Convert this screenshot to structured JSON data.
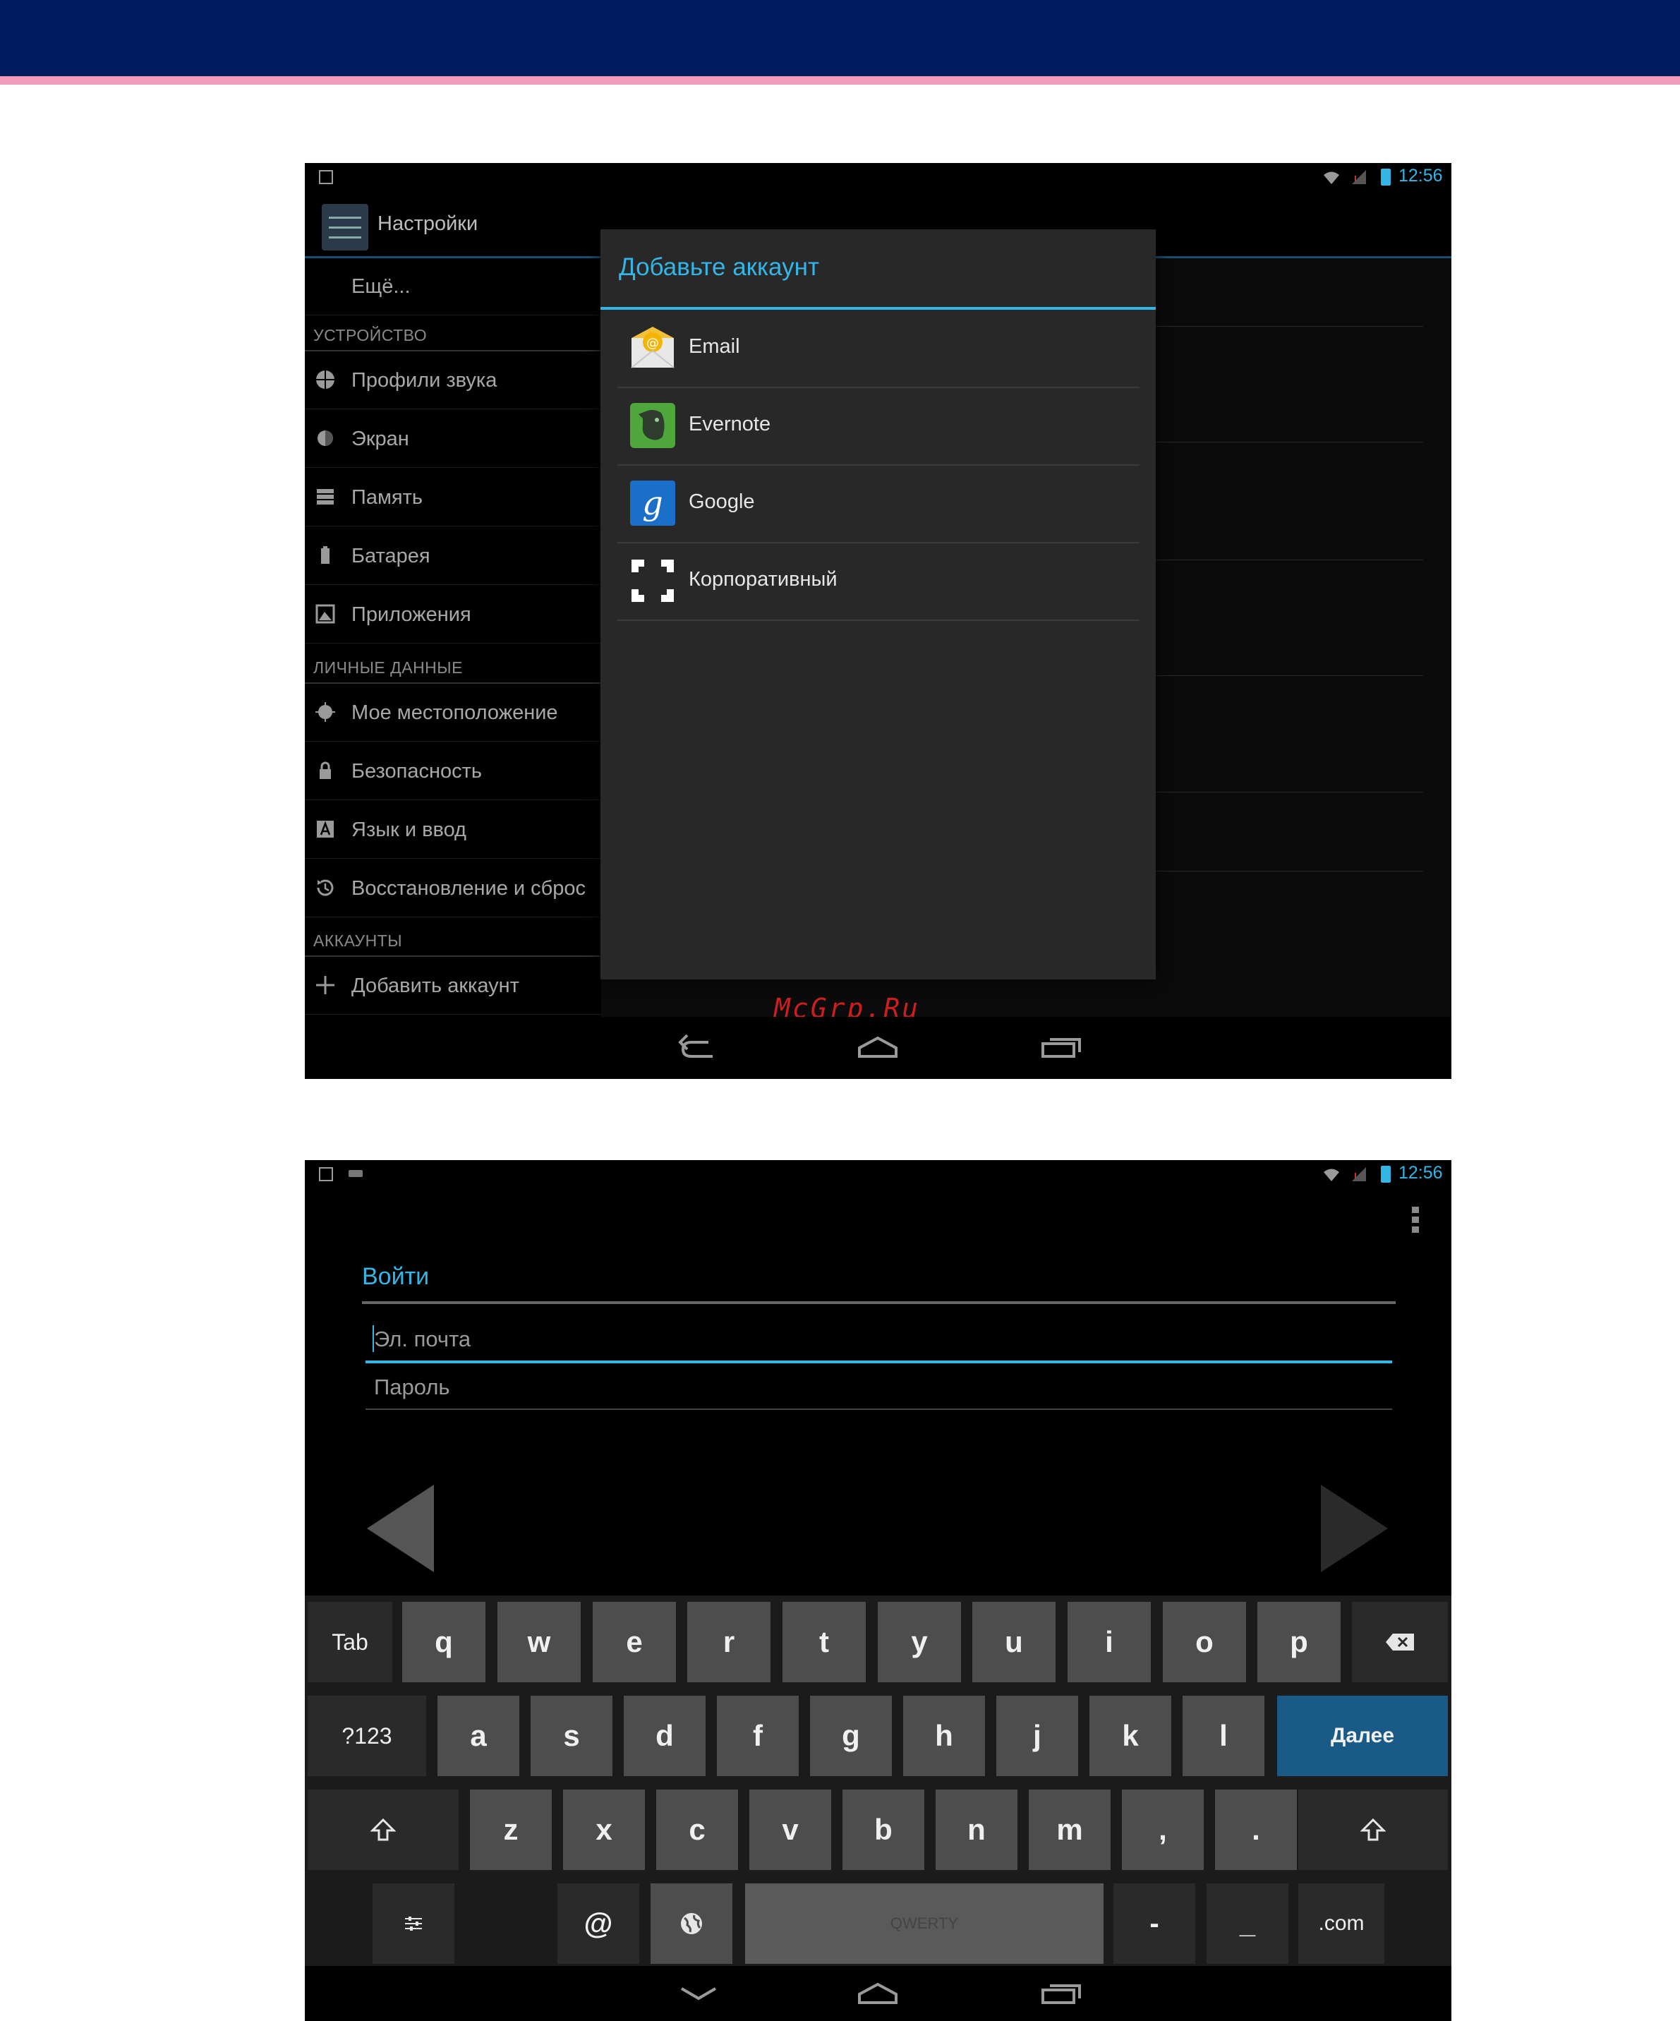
{
  "screen1": {
    "status": {
      "time": "12:56"
    },
    "action_bar": {
      "title": "Настройки"
    },
    "more_item": "Ещё...",
    "sections": [
      {
        "header": "УСТРОЙСТВО",
        "items": [
          "Профили звука",
          "Экран",
          "Память",
          "Батарея",
          "Приложения"
        ]
      },
      {
        "header": "ЛИЧНЫЕ ДАННЫЕ",
        "items": [
          "Мое местоположение",
          "Безопасность",
          "Язык и ввод",
          "Восстановление и сброс"
        ]
      },
      {
        "header": "АККАУНТЫ",
        "items": [
          "Добавить аккаунт"
        ]
      }
    ],
    "dialog": {
      "title": "Добавьте аккаунт",
      "accounts": [
        {
          "label": "Email",
          "icon": "email-envelope-icon"
        },
        {
          "label": "Evernote",
          "icon": "evernote-elephant-icon"
        },
        {
          "label": "Google",
          "icon": "google-g-icon"
        },
        {
          "label": "Корпоративный",
          "icon": "corporate-exchange-icon"
        }
      ]
    },
    "watermark": "McGrp.Ru"
  },
  "screen2": {
    "status": {
      "time": "12:56"
    },
    "title": "Войти",
    "email_placeholder": "Эл. почта",
    "password_placeholder": "Пароль",
    "keyboard": {
      "row1": [
        "Tab",
        "q",
        "w",
        "e",
        "r",
        "t",
        "y",
        "u",
        "i",
        "o",
        "p"
      ],
      "row2": [
        "?123",
        "a",
        "s",
        "d",
        "f",
        "g",
        "h",
        "j",
        "k",
        "l"
      ],
      "enter": "Далее",
      "row3": [
        "z",
        "x",
        "c",
        "v",
        "b",
        "n",
        "m",
        ",",
        "."
      ],
      "row4": {
        "at": "@",
        "space": "QWERTY",
        "dash": "-",
        "underscore": "_",
        "dotcom": ".com"
      }
    }
  },
  "colors": {
    "header": "#001b5e",
    "stripe": "#f39bbd",
    "holo_blue": "#33b5e5",
    "enter_key": "#1a5a86"
  }
}
